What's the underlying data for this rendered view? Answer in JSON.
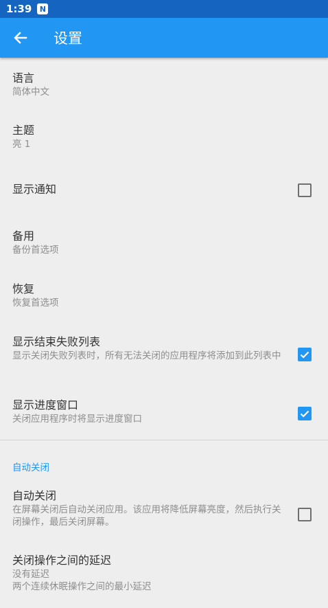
{
  "status": {
    "time": "1:39",
    "notif": "N"
  },
  "appbar": {
    "title": "设置"
  },
  "settings": [
    {
      "title": "语言",
      "summary": "简体中文"
    },
    {
      "title": "主题",
      "summary": "亮 1"
    },
    {
      "title": "显示通知",
      "checked": false
    },
    {
      "title": "备用",
      "summary": "备份首选项"
    },
    {
      "title": "恢复",
      "summary": "恢复首选项"
    },
    {
      "title": "显示结束失败列表",
      "summary": "显示关闭失败列表时，所有无法关闭的应用程序将添加到此列表中",
      "checked": true
    },
    {
      "title": "显示进度窗口",
      "summary": "关闭应用程序时将显示进度窗口",
      "checked": true
    }
  ],
  "auto_close_category": "自动关闭",
  "auto_close": {
    "title": "自动关闭",
    "summary": "在屏幕关闭后自动关闭应用。该应用将降低屏幕亮度，然后执行关闭操作，最后关闭屏幕。",
    "checked": false
  },
  "delay": {
    "title": "关闭操作之间的延迟",
    "value": "没有延迟",
    "summary": "两个连续休眠操作之间的最小延迟"
  },
  "colors": {
    "primary": "#2196f3",
    "status_bar": "#1565c0",
    "background": "#eeeeee"
  }
}
